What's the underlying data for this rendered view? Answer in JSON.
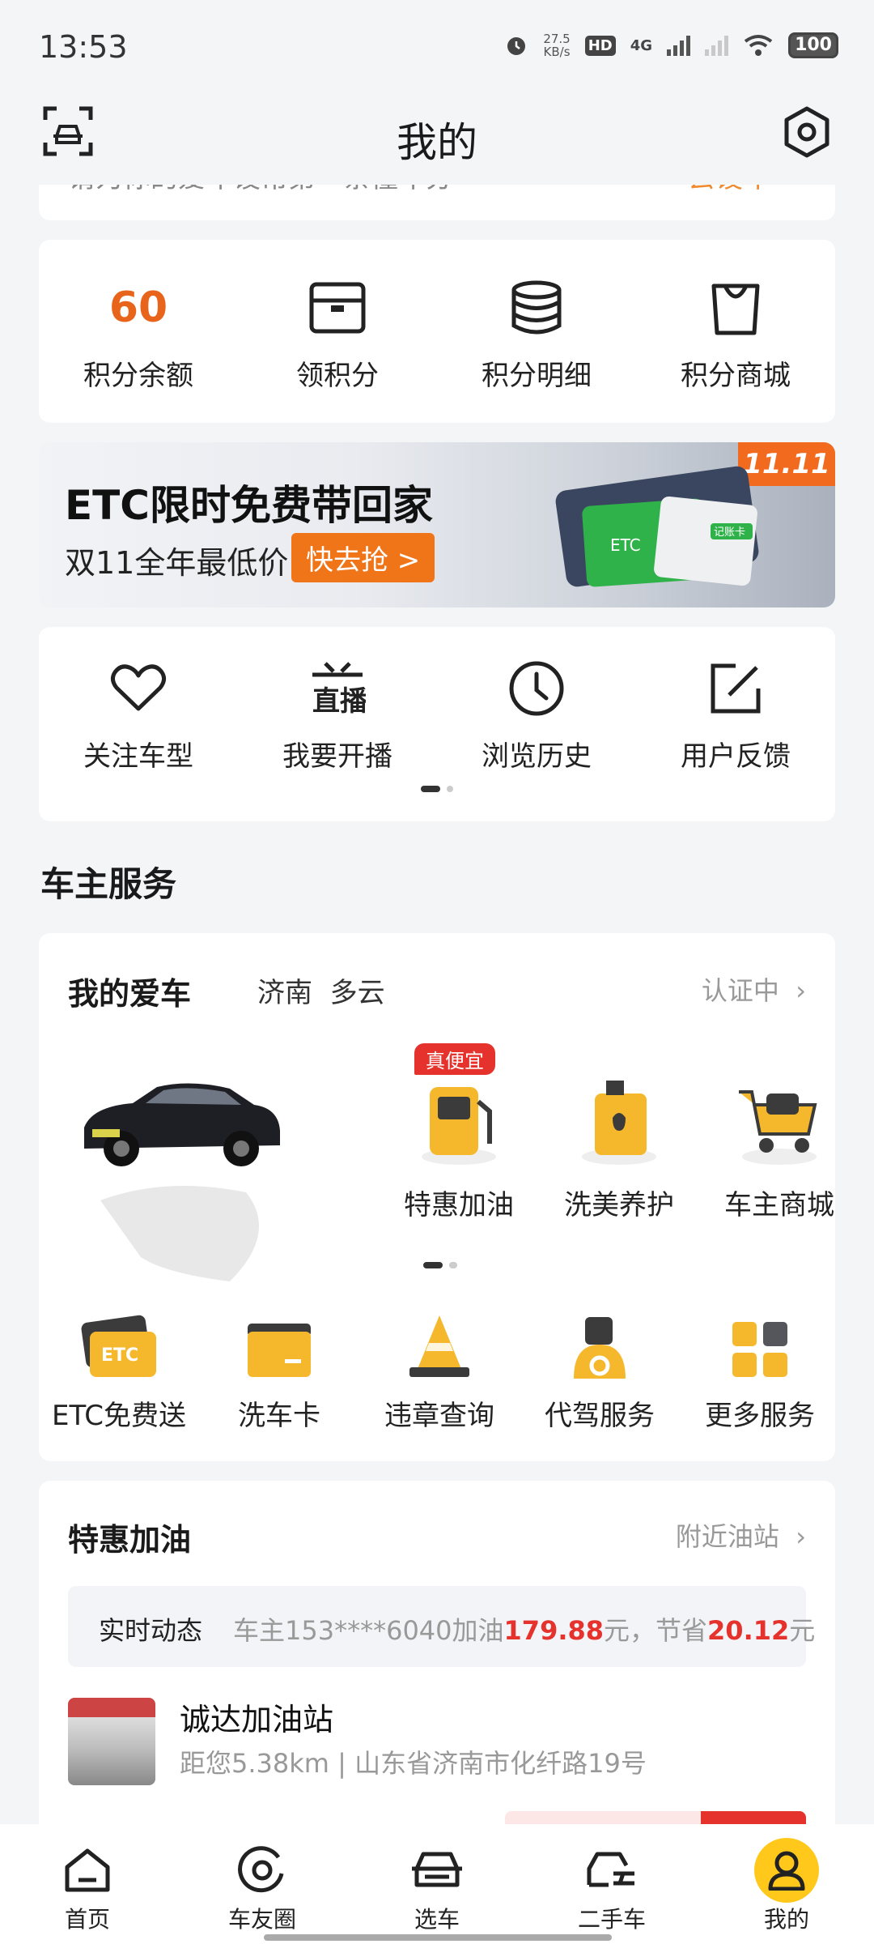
{
  "status_bar": {
    "time": "13:53",
    "speed": "27.5",
    "speed_unit": "KB/s",
    "hd": "HD",
    "net": "4G",
    "battery": "100"
  },
  "header": {
    "title": "我的"
  },
  "prev_card": {
    "text": "请为你的爱车设常第一条懂车分",
    "action": "去设车"
  },
  "points": {
    "balance": "60",
    "items": [
      {
        "label": "积分余额",
        "icon": "points-number"
      },
      {
        "label": "领积分",
        "icon": "box-icon"
      },
      {
        "label": "积分明细",
        "icon": "database-icon"
      },
      {
        "label": "积分商城",
        "icon": "shopping-bag-icon"
      }
    ]
  },
  "banner": {
    "title": "ETC限时免费带回家",
    "subtitle": "双11全年最低价",
    "cta": "快去抢 >",
    "badge": "11.11",
    "card_text": "ETC",
    "card_text2": "记账卡"
  },
  "shortcuts": [
    {
      "label": "关注车型",
      "icon": "heart-icon"
    },
    {
      "label": "我要开播",
      "icon": "live-broadcast-icon"
    },
    {
      "label": "浏览历史",
      "icon": "clock-icon"
    },
    {
      "label": "用户反馈",
      "icon": "edit-icon"
    }
  ],
  "owner_section": {
    "title": "车主服务"
  },
  "my_car": {
    "title": "我的爱车",
    "city": "济南",
    "weather": "多云",
    "auth": "认证中",
    "services": [
      {
        "label": "特惠加油",
        "tag": "真便宜",
        "icon": "fuel-pump-icon"
      },
      {
        "label": "洗美养护",
        "icon": "oil-can-icon"
      },
      {
        "label": "车主商城",
        "icon": "cart-icon"
      }
    ],
    "services2": [
      {
        "label": "ETC免费送",
        "icon": "etc-card-icon",
        "icon_text": "ETC"
      },
      {
        "label": "洗车卡",
        "icon": "wash-card-icon"
      },
      {
        "label": "违章查询",
        "icon": "traffic-cone-icon"
      },
      {
        "label": "代驾服务",
        "icon": "driver-icon"
      },
      {
        "label": "更多服务",
        "icon": "grid-icon"
      }
    ]
  },
  "fuel": {
    "title": "特惠加油",
    "nearby": "附近油站",
    "live_label": "实时动态",
    "live_prefix": "车主153****6040加油",
    "live_amount": "179.88",
    "live_mid": "元，节省",
    "live_saved": "20.12",
    "live_suffix": "元",
    "station_name": "诚达加油站",
    "station_distance": "距您5.38km",
    "station_address": "山东省济南市化纤路19号"
  },
  "tabs": [
    {
      "label": "首页",
      "icon": "home-icon"
    },
    {
      "label": "车友圈",
      "icon": "circle-icon"
    },
    {
      "label": "选车",
      "icon": "car-icon"
    },
    {
      "label": "二手车",
      "icon": "used-car-icon"
    },
    {
      "label": "我的",
      "icon": "user-icon",
      "active": true
    }
  ],
  "colors": {
    "accent": "#e8641b",
    "tab_active": "#ffc81a",
    "red": "#e5322d",
    "background": "#f4f5f7"
  }
}
